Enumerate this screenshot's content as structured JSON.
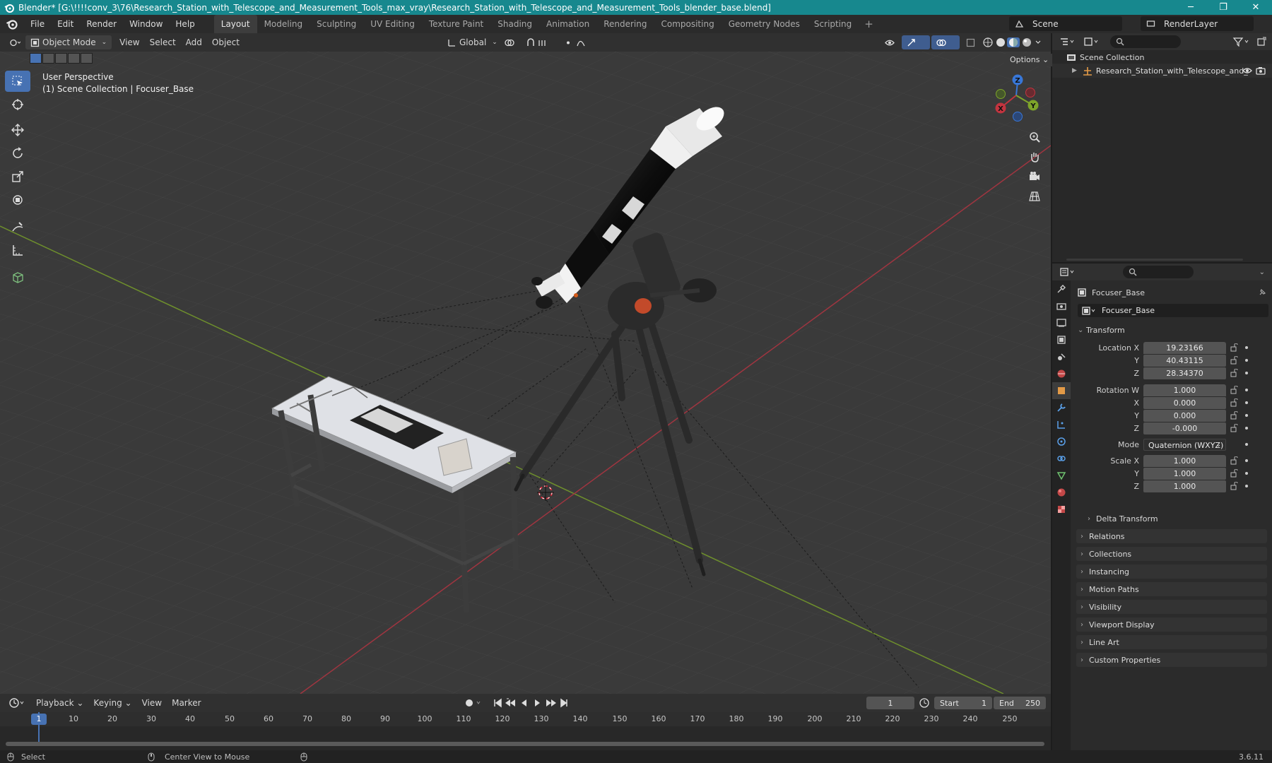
{
  "window": {
    "title": "Blender* [G:\\!!!!conv_3\\76\\Research_Station_with_Telescope_and_Measurement_Tools_max_vray\\Research_Station_with_Telescope_and_Measurement_Tools_blender_base.blend]",
    "minimize": "─",
    "maximize": "❐",
    "close": "✕"
  },
  "menu": {
    "items": [
      "File",
      "Edit",
      "Render",
      "Window",
      "Help"
    ],
    "workspaces": [
      "Layout",
      "Modeling",
      "Sculpting",
      "UV Editing",
      "Texture Paint",
      "Shading",
      "Animation",
      "Rendering",
      "Compositing",
      "Geometry Nodes",
      "Scripting"
    ],
    "active_workspace": "Layout",
    "add": "+",
    "scene": "Scene",
    "render_layer": "RenderLayer"
  },
  "viewport_header": {
    "mode": "Object Mode",
    "menus": [
      "View",
      "Select",
      "Add",
      "Object"
    ],
    "orientation": "Global",
    "options": "Options"
  },
  "viewport": {
    "perspective": "User Perspective",
    "collection_info": "(1) Scene Collection | Focuser_Base",
    "gizmo": {
      "x": "X",
      "y": "Y",
      "z": "Z"
    }
  },
  "timeline": {
    "menus": [
      "Playback",
      "Keying",
      "View",
      "Marker"
    ],
    "current_frame": "1",
    "start_label": "Start",
    "start": "1",
    "end_label": "End",
    "end": "250",
    "ticks": [
      "1",
      "10",
      "20",
      "30",
      "40",
      "50",
      "60",
      "70",
      "80",
      "90",
      "100",
      "110",
      "120",
      "130",
      "140",
      "150",
      "160",
      "170",
      "180",
      "190",
      "200",
      "210",
      "220",
      "230",
      "240",
      "250"
    ]
  },
  "status": {
    "select": "Select",
    "center": "Center View to Mouse",
    "version": "3.6.11"
  },
  "outliner": {
    "root": "Scene Collection",
    "child": "Research_Station_with_Telescope_and_"
  },
  "properties": {
    "object_name": "Focuser_Base",
    "data_name": "Focuser_Base",
    "transform_title": "Transform",
    "location_label": "Location X",
    "location": [
      "19.23166",
      "40.43115",
      "28.34370"
    ],
    "rotation_label": "Rotation W",
    "rotation": [
      "1.000",
      "0.000",
      "0.000",
      "-0.000"
    ],
    "mode_label": "Mode",
    "mode": "Quaternion (WXYZ)",
    "scale_label": "Scale X",
    "scale": [
      "1.000",
      "1.000",
      "1.000"
    ],
    "axis_y": "Y",
    "axis_z": "Z",
    "axis_x": "X",
    "delta": "Delta Transform",
    "panels": [
      "Relations",
      "Collections",
      "Instancing",
      "Motion Paths",
      "Visibility",
      "Viewport Display",
      "Line Art",
      "Custom Properties"
    ]
  },
  "colors": {
    "title_bar": "#17888e",
    "accent": "#4772b3",
    "x_axis": "#c3343f",
    "y_axis": "#7ea42a"
  }
}
